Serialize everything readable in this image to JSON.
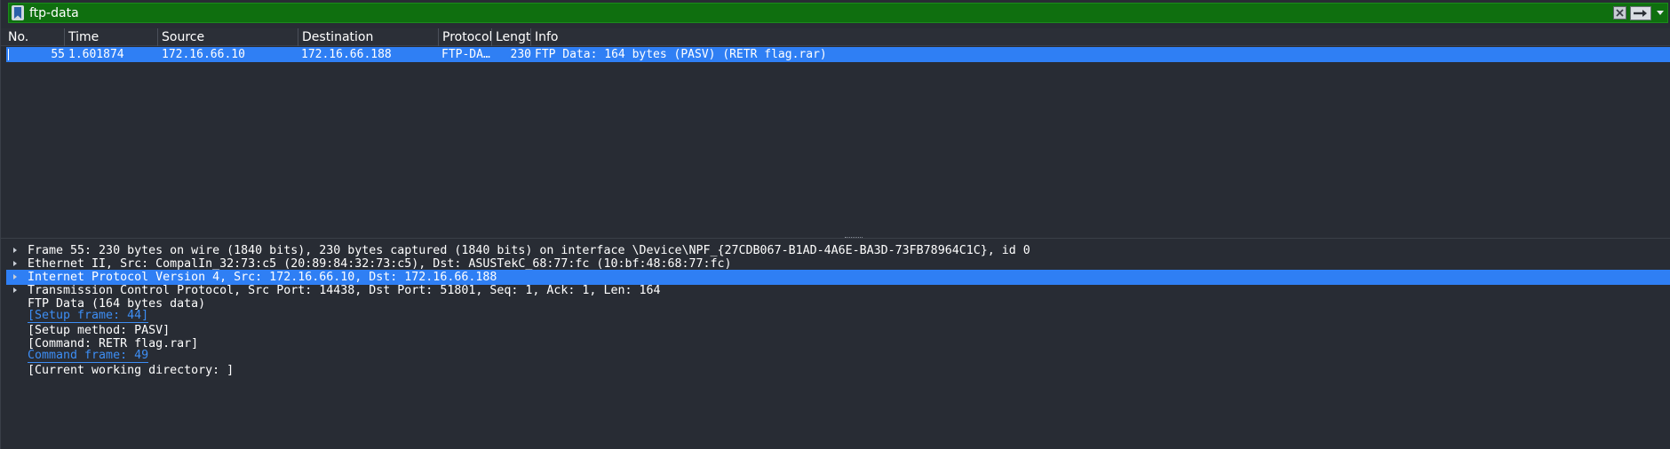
{
  "filter": {
    "value": "ftp-data"
  },
  "packet_list": {
    "columns": [
      "No.",
      "Time",
      "Source",
      "Destination",
      "Protocol",
      "Length",
      "Info"
    ],
    "rows": [
      {
        "no": "55",
        "time": "1.601874",
        "source": "172.16.66.10",
        "destination": "172.16.66.188",
        "protocol": "FTP-DA…",
        "length": "230",
        "info": "FTP Data: 164 bytes (PASV) (RETR flag.rar)"
      }
    ]
  },
  "details": {
    "frame": "Frame 55: 230 bytes on wire (1840 bits), 230 bytes captured (1840 bits) on interface \\Device\\NPF_{27CDB067-B1AD-4A6E-BA3D-73FB78964C1C}, id 0",
    "ethernet": "Ethernet II, Src: CompalIn_32:73:c5 (20:89:84:32:73:c5), Dst: ASUSTekC_68:77:fc (10:bf:48:68:77:fc)",
    "ip": "Internet Protocol Version 4, Src: 172.16.66.10, Dst: 172.16.66.188",
    "tcp": "Transmission Control Protocol, Src Port: 14438, Dst Port: 51801, Seq: 1, Ack: 1, Len: 164",
    "ftp_data": "FTP Data (164 bytes data)",
    "setup_frame": "[Setup frame: 44]",
    "setup_method": "[Setup method: PASV]",
    "command": "[Command: RETR flag.rar]",
    "command_frame": "Command frame: 49",
    "cwd": "[Current working directory: ]"
  },
  "colors": {
    "background": "#282c34",
    "filter_valid_bg": "#0f6f0f",
    "selection": "#2f7ff4",
    "link": "#3d8ef5"
  }
}
